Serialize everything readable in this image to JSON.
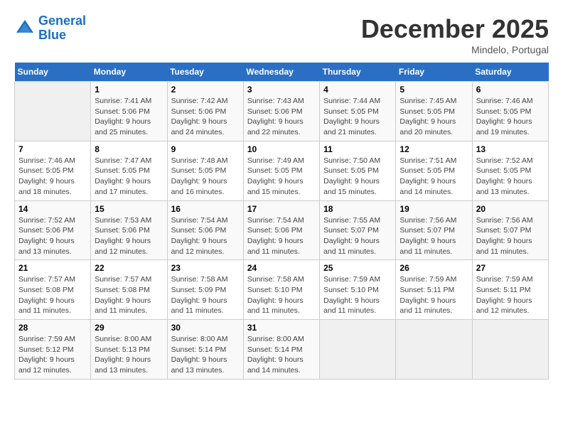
{
  "header": {
    "logo_line1": "General",
    "logo_line2": "Blue",
    "month": "December 2025",
    "location": "Mindelo, Portugal"
  },
  "weekdays": [
    "Sunday",
    "Monday",
    "Tuesday",
    "Wednesday",
    "Thursday",
    "Friday",
    "Saturday"
  ],
  "weeks": [
    [
      {
        "num": "",
        "info": ""
      },
      {
        "num": "1",
        "info": "Sunrise: 7:41 AM\nSunset: 5:06 PM\nDaylight: 9 hours\nand 25 minutes."
      },
      {
        "num": "2",
        "info": "Sunrise: 7:42 AM\nSunset: 5:06 PM\nDaylight: 9 hours\nand 24 minutes."
      },
      {
        "num": "3",
        "info": "Sunrise: 7:43 AM\nSunset: 5:06 PM\nDaylight: 9 hours\nand 22 minutes."
      },
      {
        "num": "4",
        "info": "Sunrise: 7:44 AM\nSunset: 5:05 PM\nDaylight: 9 hours\nand 21 minutes."
      },
      {
        "num": "5",
        "info": "Sunrise: 7:45 AM\nSunset: 5:05 PM\nDaylight: 9 hours\nand 20 minutes."
      },
      {
        "num": "6",
        "info": "Sunrise: 7:46 AM\nSunset: 5:05 PM\nDaylight: 9 hours\nand 19 minutes."
      }
    ],
    [
      {
        "num": "7",
        "info": "Sunrise: 7:46 AM\nSunset: 5:05 PM\nDaylight: 9 hours\nand 18 minutes."
      },
      {
        "num": "8",
        "info": "Sunrise: 7:47 AM\nSunset: 5:05 PM\nDaylight: 9 hours\nand 17 minutes."
      },
      {
        "num": "9",
        "info": "Sunrise: 7:48 AM\nSunset: 5:05 PM\nDaylight: 9 hours\nand 16 minutes."
      },
      {
        "num": "10",
        "info": "Sunrise: 7:49 AM\nSunset: 5:05 PM\nDaylight: 9 hours\nand 15 minutes."
      },
      {
        "num": "11",
        "info": "Sunrise: 7:50 AM\nSunset: 5:05 PM\nDaylight: 9 hours\nand 15 minutes."
      },
      {
        "num": "12",
        "info": "Sunrise: 7:51 AM\nSunset: 5:05 PM\nDaylight: 9 hours\nand 14 minutes."
      },
      {
        "num": "13",
        "info": "Sunrise: 7:52 AM\nSunset: 5:05 PM\nDaylight: 9 hours\nand 13 minutes."
      }
    ],
    [
      {
        "num": "14",
        "info": "Sunrise: 7:52 AM\nSunset: 5:06 PM\nDaylight: 9 hours\nand 13 minutes."
      },
      {
        "num": "15",
        "info": "Sunrise: 7:53 AM\nSunset: 5:06 PM\nDaylight: 9 hours\nand 12 minutes."
      },
      {
        "num": "16",
        "info": "Sunrise: 7:54 AM\nSunset: 5:06 PM\nDaylight: 9 hours\nand 12 minutes."
      },
      {
        "num": "17",
        "info": "Sunrise: 7:54 AM\nSunset: 5:06 PM\nDaylight: 9 hours\nand 11 minutes."
      },
      {
        "num": "18",
        "info": "Sunrise: 7:55 AM\nSunset: 5:07 PM\nDaylight: 9 hours\nand 11 minutes."
      },
      {
        "num": "19",
        "info": "Sunrise: 7:56 AM\nSunset: 5:07 PM\nDaylight: 9 hours\nand 11 minutes."
      },
      {
        "num": "20",
        "info": "Sunrise: 7:56 AM\nSunset: 5:07 PM\nDaylight: 9 hours\nand 11 minutes."
      }
    ],
    [
      {
        "num": "21",
        "info": "Sunrise: 7:57 AM\nSunset: 5:08 PM\nDaylight: 9 hours\nand 11 minutes."
      },
      {
        "num": "22",
        "info": "Sunrise: 7:57 AM\nSunset: 5:08 PM\nDaylight: 9 hours\nand 11 minutes."
      },
      {
        "num": "23",
        "info": "Sunrise: 7:58 AM\nSunset: 5:09 PM\nDaylight: 9 hours\nand 11 minutes."
      },
      {
        "num": "24",
        "info": "Sunrise: 7:58 AM\nSunset: 5:10 PM\nDaylight: 9 hours\nand 11 minutes."
      },
      {
        "num": "25",
        "info": "Sunrise: 7:59 AM\nSunset: 5:10 PM\nDaylight: 9 hours\nand 11 minutes."
      },
      {
        "num": "26",
        "info": "Sunrise: 7:59 AM\nSunset: 5:11 PM\nDaylight: 9 hours\nand 11 minutes."
      },
      {
        "num": "27",
        "info": "Sunrise: 7:59 AM\nSunset: 5:11 PM\nDaylight: 9 hours\nand 12 minutes."
      }
    ],
    [
      {
        "num": "28",
        "info": "Sunrise: 7:59 AM\nSunset: 5:12 PM\nDaylight: 9 hours\nand 12 minutes."
      },
      {
        "num": "29",
        "info": "Sunrise: 8:00 AM\nSunset: 5:13 PM\nDaylight: 9 hours\nand 13 minutes."
      },
      {
        "num": "30",
        "info": "Sunrise: 8:00 AM\nSunset: 5:14 PM\nDaylight: 9 hours\nand 13 minutes."
      },
      {
        "num": "31",
        "info": "Sunrise: 8:00 AM\nSunset: 5:14 PM\nDaylight: 9 hours\nand 14 minutes."
      },
      {
        "num": "",
        "info": ""
      },
      {
        "num": "",
        "info": ""
      },
      {
        "num": "",
        "info": ""
      }
    ]
  ]
}
